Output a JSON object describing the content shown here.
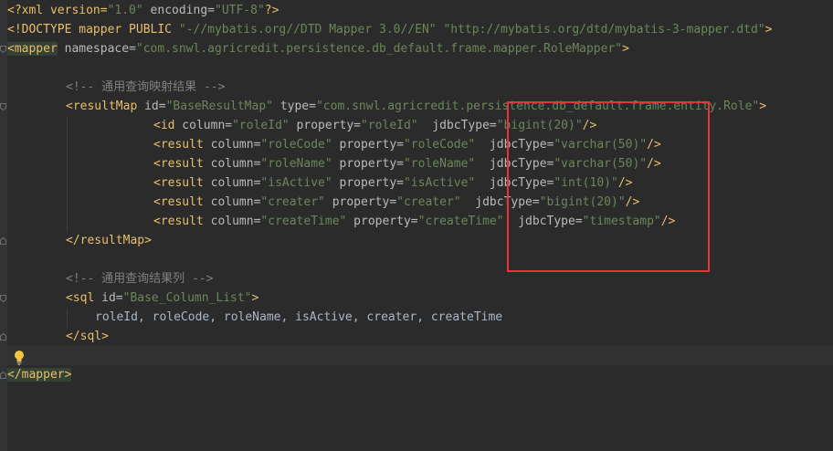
{
  "editor": {
    "lines": {
      "l1": {
        "a": "<?xml version=",
        "b": "\"1.0\"",
        "c": " encoding=",
        "d": "\"UTF-8\"",
        "e": "?>"
      },
      "l2": {
        "a": "<!DOCTYPE mapper PUBLIC ",
        "b": "\"-//mybatis.org//DTD Mapper 3.0//EN\"",
        "c": " ",
        "d": "\"http://mybatis.org/dtd/mybatis-3-mapper.dtd\"",
        "e": ">"
      },
      "l3": {
        "a": "<mapper",
        "b": " namespace=",
        "c": "\"com.snwl.agricredit.persistence.db_default.frame.mapper.RoleMapper\"",
        "d": ">"
      },
      "l5": {
        "a": "<!-- 通用查询映射结果 -->"
      },
      "l6": {
        "a": "<resultMap",
        "b": " id=",
        "c": "\"BaseResultMap\"",
        "d": " type=",
        "e": "\"com.snwl.agricredit.persistence.db_default.frame.entity.Role\"",
        "f": ">"
      },
      "l7": {
        "a": "<id",
        "b": " column=",
        "c": "\"roleId\"",
        "d": " property=",
        "e": "\"roleId\"",
        "f": "  jdbcType=",
        "g": "\"bigint(20)\"",
        "h": "/>"
      },
      "l8": {
        "a": "<result",
        "b": " column=",
        "c": "\"roleCode\"",
        "d": " property=",
        "e": "\"roleCode\"",
        "f": "  jdbcType=",
        "g": "\"varchar(50)\"",
        "h": "/>"
      },
      "l9": {
        "a": "<result",
        "b": " column=",
        "c": "\"roleName\"",
        "d": " property=",
        "e": "\"roleName\"",
        "f": "  jdbcType=",
        "g": "\"varchar(50)\"",
        "h": "/>"
      },
      "l10": {
        "a": "<result",
        "b": " column=",
        "c": "\"isActive\"",
        "d": " property=",
        "e": "\"isActive\"",
        "f": "  jdbcType=",
        "g": "\"int(10)\"",
        "h": "/>"
      },
      "l11": {
        "a": "<result",
        "b": " column=",
        "c": "\"creater\"",
        "d": " property=",
        "e": "\"creater\"",
        "f": "  jdbcType=",
        "g": "\"bigint(20)\"",
        "h": "/>"
      },
      "l12": {
        "a": "<result",
        "b": " column=",
        "c": "\"createTime\"",
        "d": " property=",
        "e": "\"createTime\"",
        "f": "  jdbcType=",
        "g": "\"timestamp\"",
        "h": "/>"
      },
      "l13": {
        "a": "</resultMap>"
      },
      "l15": {
        "a": "<!-- 通用查询结果列 -->"
      },
      "l16": {
        "a": "<sql",
        "b": " id=",
        "c": "\"Base_Column_List\"",
        "d": ">"
      },
      "l17": {
        "a": "roleId, roleCode, roleName, isActive, creater, createTime"
      },
      "l18": {
        "a": "</sql>"
      },
      "l20": {
        "a": "</mapper>"
      }
    }
  },
  "colors": {
    "background": "#2b2b2b",
    "tag": "#e8bf6a",
    "attribute": "#bababa",
    "value": "#6a8759",
    "comment": "#808080",
    "annotation_box": "#e8333b"
  }
}
